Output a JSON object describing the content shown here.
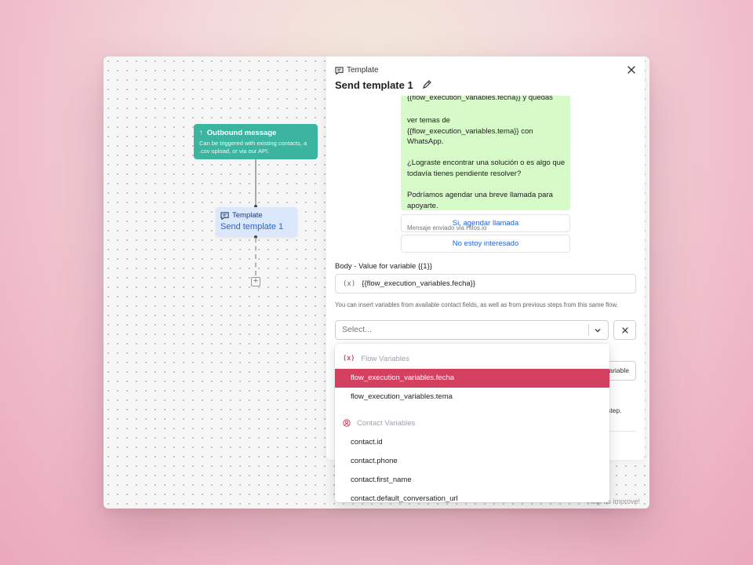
{
  "canvas": {
    "outbound_node": {
      "title": "Outbound message",
      "description": "Can be triggered with existing contacts, a .csv upload, or via our API."
    },
    "template_node": {
      "label": "Template",
      "name": "Send template 1"
    },
    "help_text": "Help us improve!"
  },
  "panel": {
    "kicker": "Template",
    "title": "Send template 1",
    "message_partial_top": "{{flow_execution_variables.fecha}} y quedas",
    "message_body": "ver temas de\n{{flow_execution_variables.tema}} con\nWhatsApp.\n\n¿Lograste encontrar una solución o es algo que todavía tienes pendiente resolver?\n\nPodríamos agendar una breve llamada para apoyarte.",
    "message_footer": "Mensaje enviado via Hilos.io",
    "quick_replies": [
      "Si, agendar llamada",
      "No estoy interesado"
    ],
    "body_variable_label": "Body - Value for variable {{1}}",
    "body_variable_value": "{{flow_execution_variables.fecha}}",
    "variable_icon": "(x)",
    "help_text": "You can insert variables from available contact fields, as well as from previous steps from this same flow.",
    "select_placeholder": "Select...",
    "behind_button_text": "variable",
    "behind_text": "step."
  },
  "dropdown": {
    "flow_group_label": "Flow Variables",
    "flow_options": [
      "flow_execution_variables.fecha",
      "flow_execution_variables.tema"
    ],
    "selected_option": "flow_execution_variables.fecha",
    "contact_group_label": "Contact Variables",
    "contact_options": [
      "contact.id",
      "contact.phone",
      "contact.first_name",
      "contact.default_conversation_url"
    ]
  },
  "colors": {
    "outbound_green": "#3bb5a0",
    "template_blue": "#dbe8fb",
    "selected_red": "#d4405f",
    "whatsapp_bubble": "#d6fbc9",
    "link_blue": "#2563d9"
  }
}
